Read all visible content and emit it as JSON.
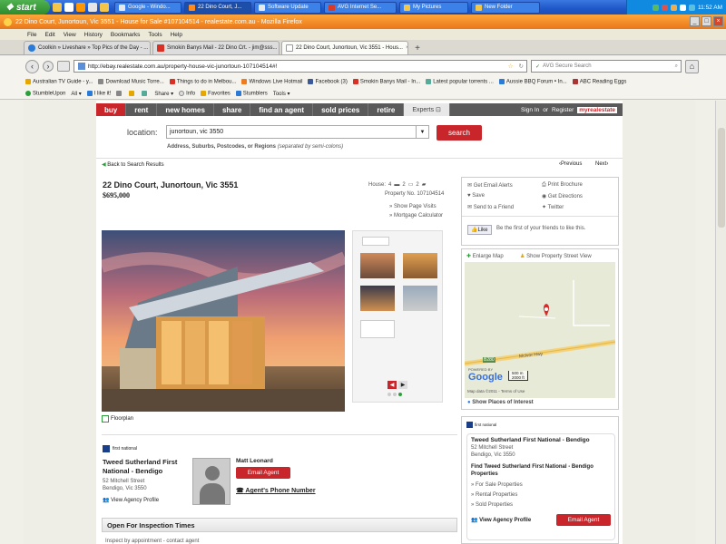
{
  "taskbar": {
    "start_label": "start",
    "tasks": [
      "Google - Windo...",
      "22 Dino Court, J...",
      "Software Update",
      "AVG Internet Se...",
      "My Pictures",
      "New Folder"
    ],
    "clock": "11:52 AM"
  },
  "window": {
    "title": "22 Dino Court, Junortoun, Vic 3551 - House for Sale #107104514 - realestate.com.au - Mozilla Firefox"
  },
  "menu": [
    "File",
    "Edit",
    "View",
    "History",
    "Bookmarks",
    "Tools",
    "Help"
  ],
  "tabs": [
    {
      "label": "Coolkin » Liveshare » Top Pics of the Day - ...",
      "selected": false
    },
    {
      "label": "Smokin Banys Mail - 22 Dino Crt. - jim@sss...",
      "selected": false
    },
    {
      "label": "22 Dino Court, Junortoun, Vic 3551 - Hous...",
      "selected": true
    }
  ],
  "nav": {
    "url": "http://ebay.realestate.com.au/property-house-vic-junortoun-107104514#!",
    "search_placeholder": "AVG Secure Search"
  },
  "bookmarks": [
    "Australian TV Guide - y...",
    "Download Music Torre...",
    "Things to do in Melbou...",
    "Windows Live Hotmail",
    "Facebook (3)",
    "Smokin Banys Mail - In...",
    "Latest popular torrents ...",
    "Aussie BBQ Forum • In...",
    "ABC Reading Eggs"
  ],
  "toolbar2": [
    "StumbleUpon",
    "All ▾",
    "I like it!",
    "Share ▾",
    "Info",
    "Favorites",
    "Stumblers",
    "Tools ▾"
  ],
  "site": {
    "nav": [
      "buy",
      "rent",
      "new homes",
      "share",
      "find an agent",
      "sold prices",
      "retire"
    ],
    "experts": "Experts",
    "signin": "Sign In",
    "or": "or",
    "register": "Register",
    "brand": "myrealestate",
    "location_label": "location:",
    "location_value": "junortoun, vic 3550",
    "location_hint": "Address, Suburbs, Postcodes, or Regions",
    "location_hint_sub": "(separated by semi-colons)",
    "search_button": "search",
    "back": "Back to Search Results",
    "previous": "Previous",
    "next": "Next"
  },
  "listing": {
    "address": "22 Dino Court, Junortoun, Vic 3551",
    "price": "$695,000",
    "type": "House:",
    "beds": "4",
    "baths": "2",
    "cars": "2",
    "property_no": "Property No. 107104514",
    "page_visits": "Show Page Visits",
    "mortgage": "Mortgage Calculator",
    "floorplan": "Floorplan"
  },
  "actions": {
    "email_alerts": "Get Email Alerts",
    "print": "Print Brochure",
    "save": "Save",
    "directions": "Get Directions",
    "send_friend": "Send to a Friend",
    "twitter": "Twitter",
    "like": "Like",
    "like_text": "Be the first of your friends to like this."
  },
  "map": {
    "enlarge": "Enlarge Map",
    "street_view": "Show Property Street View",
    "road": "McIvor Hwy",
    "road_no": "B280",
    "scale_m": "500 m",
    "scale_ft": "2000 ft",
    "copyright": "Map data ©2011 - Terms of Use",
    "places": "Show Places of Interest",
    "powered": "POWERED BY",
    "google": "Google"
  },
  "agency": {
    "name": "Tweed Sutherland First National - Bendigo",
    "logo_text": "first national",
    "street": "52 Mitchell Street",
    "suburb": "Bendigo, Vic 3550",
    "view_profile": "View Agency Profile",
    "agent_name": "Matt Leonard",
    "email_agent": "Email Agent",
    "phone": "Agent's Phone Number"
  },
  "side_agency": {
    "name": "Tweed Sutherland First National - Bendigo",
    "street": "52 Mitchell Street",
    "suburb": "Bendigo, Vic 3550",
    "find_text": "Find Tweed Sutherland First National - Bendigo Properties",
    "links": [
      "For Sale Properties",
      "Rental Properties",
      "Sold Properties"
    ],
    "view_profile": "View Agency Profile",
    "email_agent": "Email Agent"
  },
  "inspection": {
    "title": "Open For Inspection Times",
    "text": "Inspect by appointment - contact agent"
  },
  "colors": {
    "brand_red": "#c8262b",
    "taskbar_blue": "#1f57c8",
    "firefox_orange": "#e9761a"
  }
}
